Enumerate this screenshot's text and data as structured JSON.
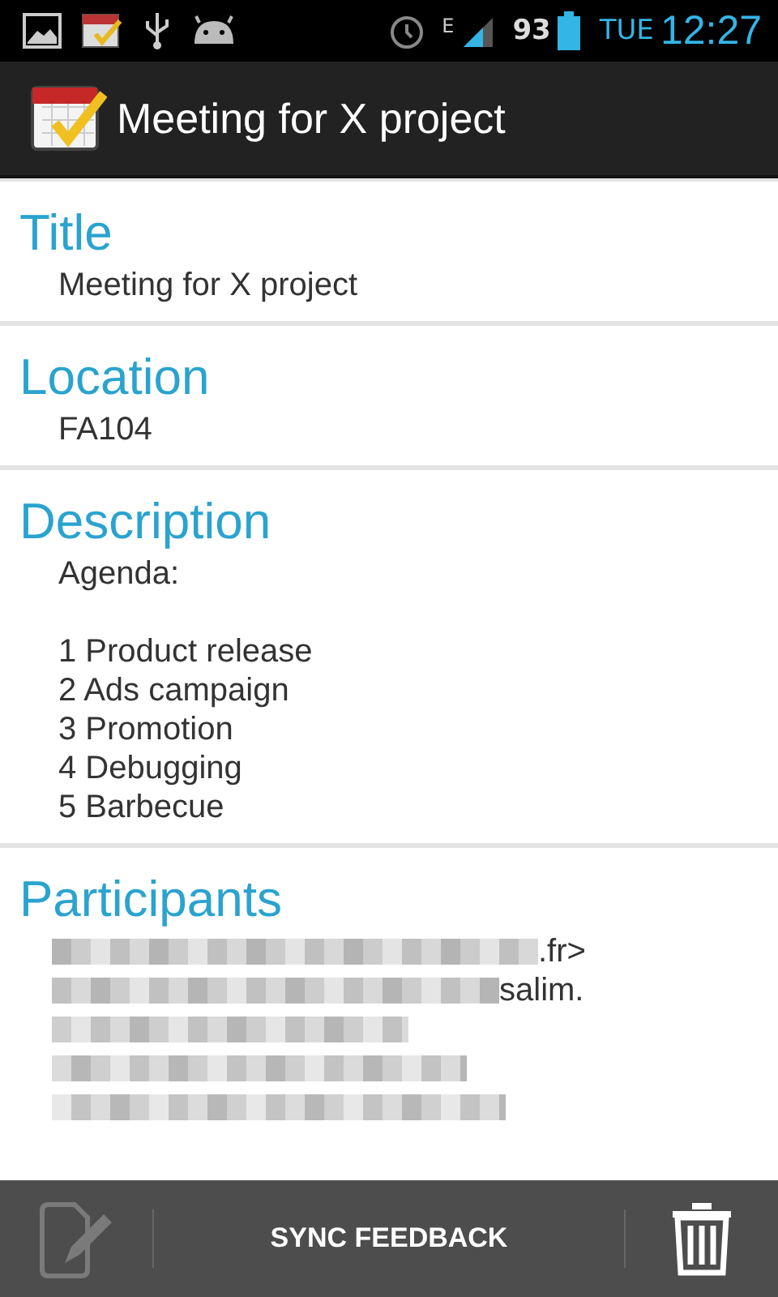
{
  "status_bar": {
    "network": "E",
    "battery": "93",
    "day": "TUE",
    "time": "12:27"
  },
  "action_bar": {
    "title": "Meeting for X project"
  },
  "sections": [
    {
      "kind": "text",
      "heading": "Title",
      "paragraphs": [
        [
          "Meeting for X project"
        ]
      ]
    },
    {
      "kind": "text",
      "heading": "Location",
      "paragraphs": [
        [
          "FA104"
        ]
      ]
    },
    {
      "kind": "text",
      "heading": "Description",
      "paragraphs": [
        [
          "Agenda:"
        ],
        [
          "1 Product release",
          "2 Ads campaign",
          "3 Promotion",
          "4 Debugging",
          "5 Barbecue"
        ]
      ]
    },
    {
      "kind": "redacted",
      "heading": "Participants",
      "lines": [
        {
          "redacted": true,
          "text": ".fr>"
        },
        {
          "redacted": true,
          "text": "salim."
        },
        {
          "redacted": true
        },
        {
          "redacted": true
        },
        {
          "redacted": true
        }
      ]
    }
  ],
  "bottom_bar": {
    "edit_disabled": true,
    "action": "SYNC FEEDBACK"
  }
}
